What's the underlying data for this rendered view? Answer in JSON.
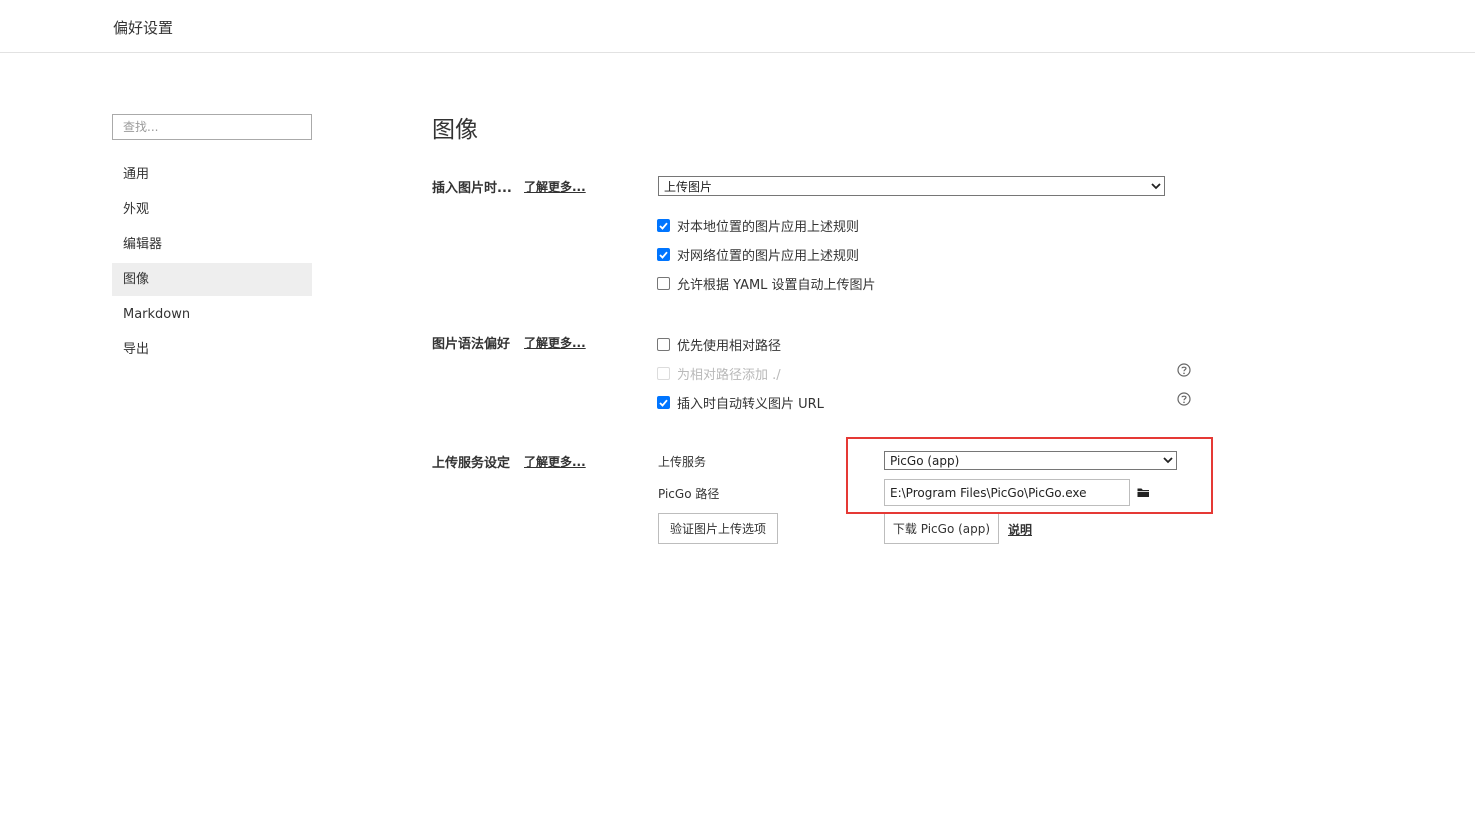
{
  "window": {
    "title": "偏好设置"
  },
  "sidebar": {
    "search_placeholder": "查找...",
    "items": [
      {
        "label": "通用"
      },
      {
        "label": "外观"
      },
      {
        "label": "编辑器"
      },
      {
        "label": "图像",
        "active": true
      },
      {
        "label": "Markdown"
      },
      {
        "label": "导出"
      }
    ]
  },
  "main": {
    "section_title": "图像",
    "insert_image": {
      "label": "插入图片时...",
      "learn_more": "了解更多...",
      "selected": "上传图片",
      "options": [
        {
          "label": "对本地位置的图片应用上述规则",
          "checked": true
        },
        {
          "label": "对网络位置的图片应用上述规则",
          "checked": true
        },
        {
          "label": "允许根据 YAML 设置自动上传图片",
          "checked": false
        }
      ]
    },
    "syntax": {
      "label": "图片语法偏好",
      "learn_more": "了解更多...",
      "options": [
        {
          "label": "优先使用相对路径",
          "checked": false
        },
        {
          "label": "为相对路径添加 ./",
          "checked": false,
          "disabled": true
        },
        {
          "label": "插入时自动转义图片 URL",
          "checked": true
        }
      ]
    },
    "upload": {
      "label": "上传服务设定",
      "learn_more": "了解更多...",
      "service_label": "上传服务",
      "service_value": "PicGo (app)",
      "path_label": "PicGo 路径",
      "path_value": "E:\\Program Files\\PicGo\\PicGo.exe",
      "verify_button": "验证图片上传选项",
      "download_button": "下载 PicGo (app)",
      "explain_link": "说明"
    }
  },
  "colors": {
    "accent": "#0075ff",
    "highlight": "#e53935",
    "active_bg": "#eeeeee"
  }
}
